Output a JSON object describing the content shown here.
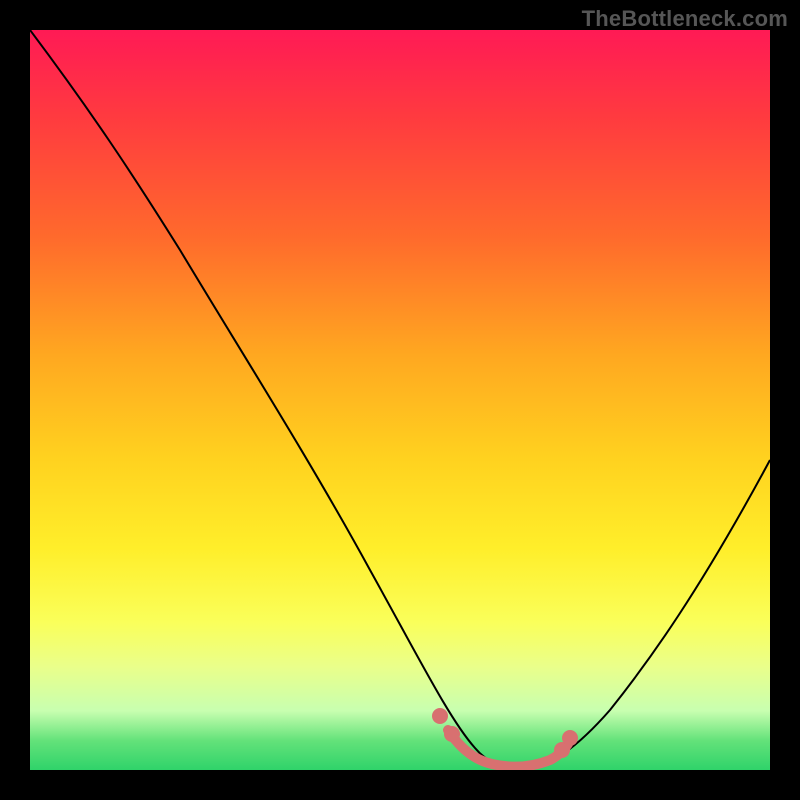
{
  "watermark": "TheBottleneck.com",
  "chart_data": {
    "type": "line",
    "title": "",
    "xlabel": "",
    "ylabel": "",
    "xlim": [
      0,
      100
    ],
    "ylim": [
      0,
      100
    ],
    "grid": false,
    "series": [
      {
        "name": "curve",
        "x": [
          0,
          8,
          18,
          28,
          38,
          48,
          55,
          60,
          64,
          68,
          76,
          84,
          92,
          100
        ],
        "y": [
          100,
          90,
          74,
          58,
          42,
          26,
          12,
          4,
          1,
          1,
          4,
          14,
          28,
          45
        ]
      }
    ],
    "annotations": {
      "highlight_segment": {
        "x": [
          56,
          60,
          64,
          68,
          72
        ],
        "y": [
          9,
          3,
          1,
          1,
          3
        ]
      },
      "highlight_dots": [
        {
          "x": 55,
          "y": 11
        },
        {
          "x": 57,
          "y": 7
        },
        {
          "x": 72,
          "y": 3
        },
        {
          "x": 73,
          "y": 5
        }
      ]
    },
    "background_gradient": {
      "stops": [
        {
          "pos": 0,
          "color": "#ff1a55"
        },
        {
          "pos": 100,
          "color": "#2fd36a"
        }
      ]
    }
  }
}
